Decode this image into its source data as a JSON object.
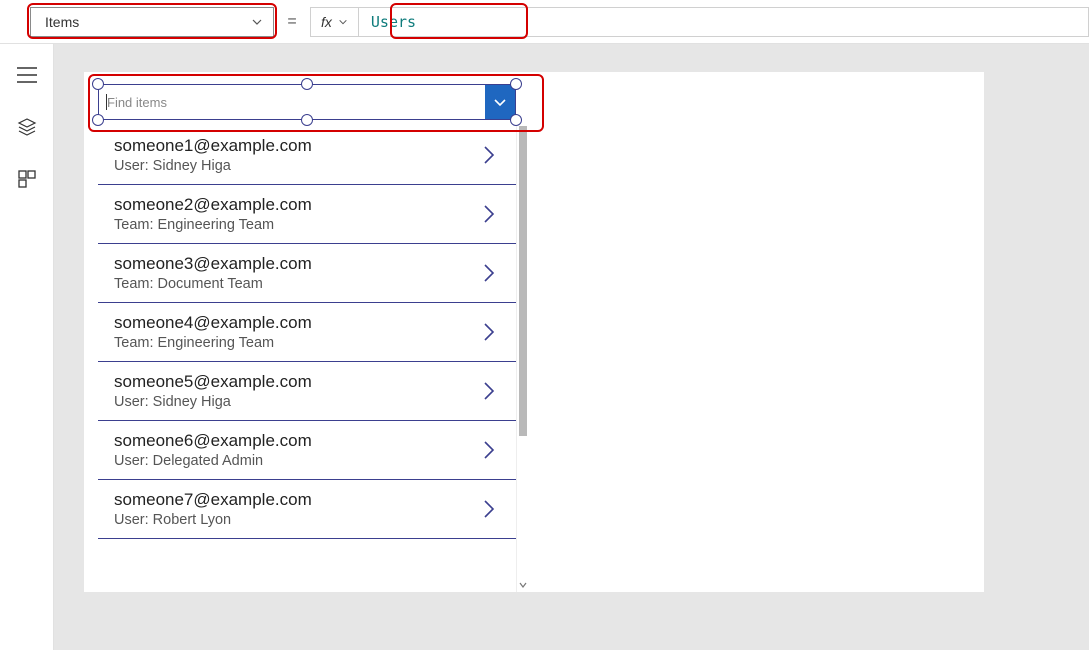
{
  "formula_bar": {
    "property_label": "Items",
    "fx_label": "fx",
    "formula_text": "Users"
  },
  "combobox": {
    "placeholder": "Find items"
  },
  "gallery": {
    "items": [
      {
        "primary": "someone1@example.com",
        "secondary": "User: Sidney Higa"
      },
      {
        "primary": "someone2@example.com",
        "secondary": "Team: Engineering Team"
      },
      {
        "primary": "someone3@example.com",
        "secondary": "Team: Document Team"
      },
      {
        "primary": "someone4@example.com",
        "secondary": "Team: Engineering Team"
      },
      {
        "primary": "someone5@example.com",
        "secondary": "User: Sidney Higa"
      },
      {
        "primary": "someone6@example.com",
        "secondary": "User: Delegated Admin"
      },
      {
        "primary": "someone7@example.com",
        "secondary": "User: Robert Lyon"
      }
    ]
  }
}
